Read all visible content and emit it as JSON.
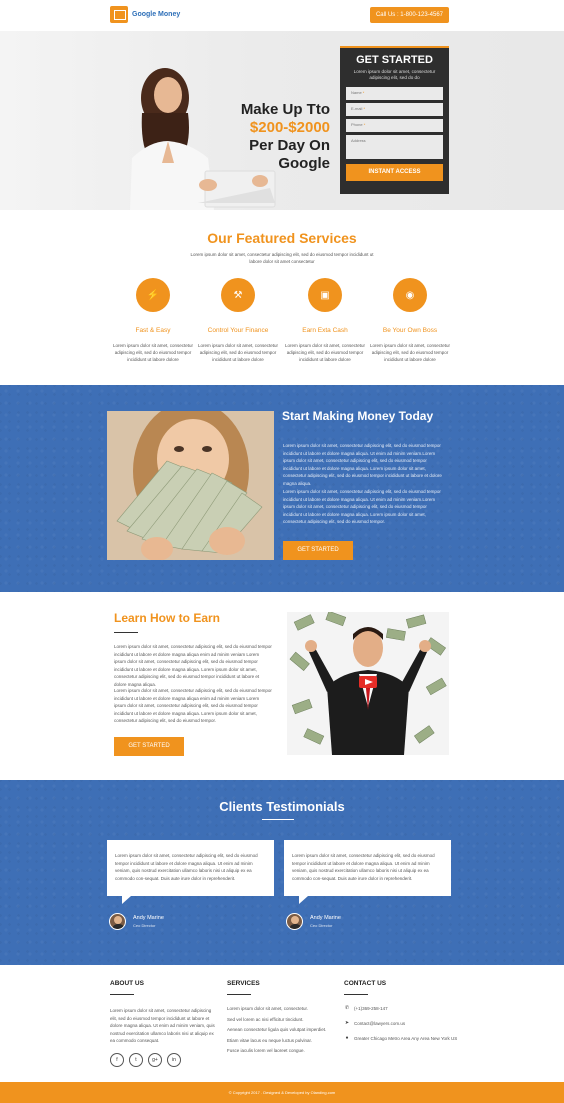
{
  "header": {
    "logo_text": "Google Money",
    "call_label": "Call Us : 1-800-123-4567"
  },
  "hero": {
    "headline_line1": "Make Up Tto",
    "headline_accent": "$200-$2000",
    "headline_line3": "Per Day On",
    "headline_line4": "Google"
  },
  "form": {
    "title": "GET STARTED",
    "subtitle": "Lorem ipsum dolor sit amet, consectetur adipiscing elit, sed do do",
    "name_placeholder": "Name",
    "email_placeholder": "E-mail",
    "phone_placeholder": "Phone",
    "address_placeholder": "Address",
    "submit_label": "INSTANT ACCESS"
  },
  "services": {
    "title": "Our Featured Services",
    "subtitle": "Lorem ipsum dolor sit amet, consectetur adipiscing elit, sed do eiusmod tempor incididunt ut labore dolor sit amet consectetur",
    "items": [
      {
        "icon": "flash-icon",
        "glyph": "⚡",
        "title": "Fast & Easy",
        "desc": "Lorem ipsum dolor sit amet, consectetur adipiscing elit, sed do eiusmod tempor incididunt ut labore dolore"
      },
      {
        "icon": "gavel-icon",
        "glyph": "⚒",
        "title": "Control Your Finance",
        "desc": "Lorem ipsum dolor sit amet, consectetur adipiscing elit, sed do eiusmod tempor incididunt ut labore dolore"
      },
      {
        "icon": "money-icon",
        "glyph": "▣",
        "title": "Earn Exta Cash",
        "desc": "Lorem ipsum dolor sit amet, consectetur adipiscing elit, sed do eiusmod tempor incididunt ut labore dolore"
      },
      {
        "icon": "eye-icon",
        "glyph": "◉",
        "title": "Be Your Own Boss",
        "desc": "Lorem ipsum dolor sit amet, consectetur adipiscing elit, sed do eiusmod tempor incididunt ut labore dolore"
      }
    ]
  },
  "money": {
    "title": "Start Making Money Today",
    "p1": "Lorem ipsum dolor sit amet, consectetur adipiscing elit, sed do eiusmod tempor incididunt ut labore et dolore magna aliqua. Ut enim ad minim veniam.Lorem ipsum dolor sit amet, consectetur adipiscing elit, sed do eiusmod tempor incididunt ut labore et dolore magna aliqua. Lorem ipsum dolor sit amet, consectetur adipiscing elit, sed do eiusmod tempor incididunt ut labore et dolore magna aliqua.",
    "p2": "Lorem ipsum dolor sit amet, consectetur adipiscing elit, sed do eiusmod tempor incididunt ut labore et dolore magna aliqua. Ut enim ad minim veniam.Lorem ipsum dolor sit amet, consectetur adipiscing elit, sed do eiusmod tempor incididunt ut labore et dolore magna aliqua. Lorem ipsum dolor sit amet, consectetur adipiscing elit, sed do eiusmod tempor.",
    "button_label": "GET STARTED"
  },
  "learn": {
    "title": "Learn How to Earn",
    "p1": "Lorem ipsum dolor sit amet, consectetur adipiscing elit, sed do eiusmod tempor incididunt ut labore et dolore magna aliqua enim ad minim veniam Lorem ipsum dolor sit amet, consectetur adipiscing elit, sed do eiusmod tempor incididunt ut labore et dolore magna aliqua. Lorem ipsum dolor sit amet, consectetur adipiscing elit, sed do eiusmod tempor incididunt ut labore et dolore magna aliqua.",
    "p2": "Lorem ipsum dolor sit amet, consectetur adipiscing elit, sed do eiusmod tempor incididunt ut labore et dolore magna aliqua enim ad minim veniam Lorem ipsum dolor sit amet, consectetur adipiscing elit, sed do eiusmod tempor incididunt ut labore et dolore magna aliqua. Lorem ipsum dolor sit amet, consectetur adipiscing elit, sed do eiusmod tempor.",
    "button_label": "GET STARTED"
  },
  "testimonials": {
    "title": "Clients Testimonials",
    "items": [
      {
        "text": "Lorem ipsum dolor sit amet, consectetur adipiscing elit, sed do eiusmod tempor incididunt ut labore et dolore magna aliqua. Ut enim ad minim veniam, quis nostrud exercitation ullamco laboris nisi ut aliquip ex ea commodo con-sequat. Duis aute irure dolor in reprehenderit.",
        "name": "Andy Marine",
        "role": "Ceo Director"
      },
      {
        "text": "Lorem ipsum dolor sit amet, consectetur adipiscing elit, sed do eiusmod tempor incididunt ut labore et dolore magna aliqua. Ut enim ad minim veniam, quis nostrud exercitation ullamco laboris nisi ut aliquip ex ea commodo con-sequat. Duis aute irure dolor in reprehenderit.",
        "name": "Andy Marine",
        "role": "Ceo Director"
      }
    ]
  },
  "footer": {
    "about_title": "ABOUT US",
    "about_text": "Lorem ipsum dolor sit amet, consectetur adipiscing elit, sed do eiusmod tempor incididunt ut labore et dolore magna aliqua. Ut enim ad minim veniam, quis nostrud exercitation ullamco laboris nisi ut aliquip ex ea commodo consequat.",
    "social": [
      "f",
      "t",
      "g+",
      "in"
    ],
    "services_title": "SERVICES",
    "services_items": [
      "Lorem ipsum dolor sit amet, consectetur.",
      "Sed vel lorem ac nisi efficitur tincidunt.",
      "Aenean consectetur ligula quis volutpat imperdiet.",
      "Etiam vitae lacus eu neque luctus pulvinar.",
      "Fusce iaculis lorem vel laoreet congue."
    ],
    "contact_title": "CONTACT US",
    "phone": "(+1)369-258-147",
    "email": "Contact@lawyers.com.us",
    "address": "Greater Chicago Metro Area Any Area New York US",
    "copyright": "© Copyright 2017 . Designed & Developed by Olanding.com"
  },
  "colors": {
    "accent": "#f0931e",
    "blue": "#3e6fb6",
    "dark_form": "#2e2e2e"
  }
}
